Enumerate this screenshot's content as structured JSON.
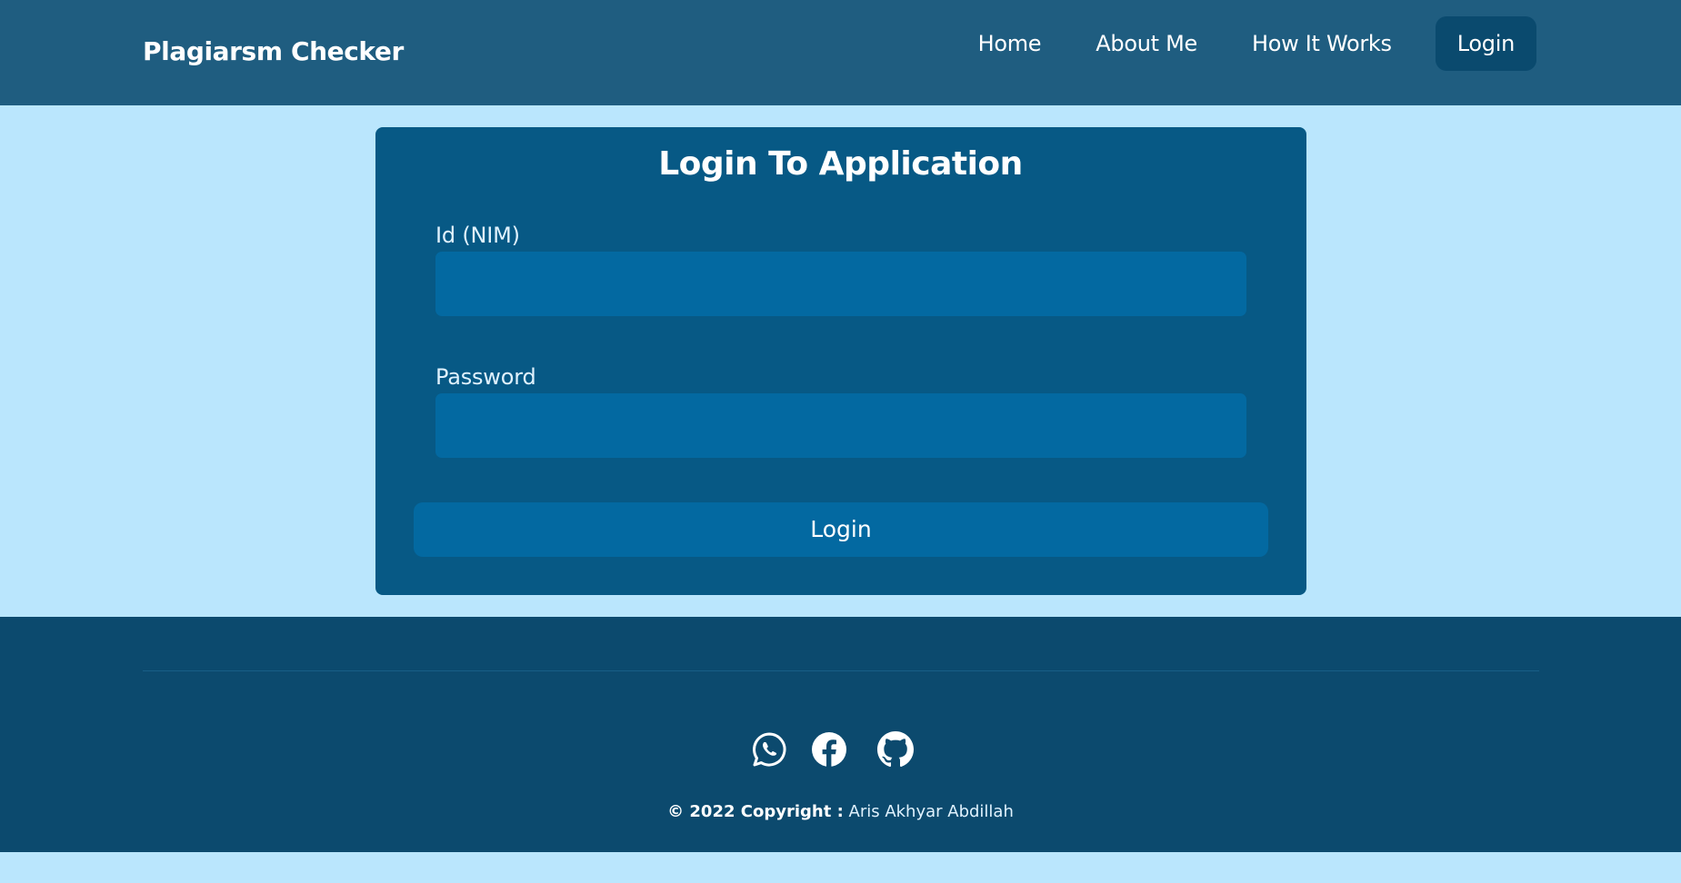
{
  "navbar": {
    "brand": "Plagiarsm Checker",
    "links": [
      {
        "label": "Home"
      },
      {
        "label": "About Me"
      },
      {
        "label": "How It Works"
      }
    ],
    "login_label": "Login"
  },
  "form": {
    "title": "Login To Application",
    "id_label": "Id (NIM)",
    "id_value": "",
    "password_label": "Password",
    "password_value": "",
    "submit_label": "Login"
  },
  "footer": {
    "social": [
      {
        "icon": "whatsapp-icon"
      },
      {
        "icon": "facebook-icon"
      },
      {
        "icon": "github-icon"
      }
    ],
    "copyright_prefix": "© 2022 Copyright :",
    "copyright_name": "Aris Akhyar Abdillah"
  },
  "colors": {
    "page_background": "#bae6fd",
    "navbar": "#1f5d80",
    "card": "#075985",
    "input": "#0369a1",
    "footer": "#0c4a6e",
    "nav_login_button": "#0a4a6e"
  }
}
